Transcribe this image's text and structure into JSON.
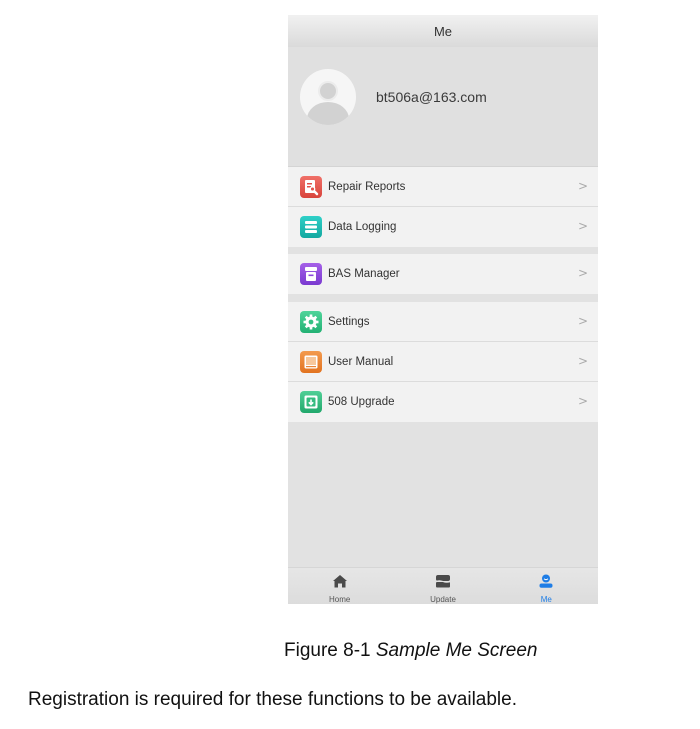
{
  "screen": {
    "header": {
      "title": "Me"
    },
    "profile": {
      "email": "bt506a@163.com",
      "avatar_icon": "user-avatar-icon"
    },
    "menu_groups": [
      {
        "items": [
          {
            "label": "Repair Reports",
            "icon": "repair-report-icon",
            "color": "#e0514a"
          },
          {
            "label": "Data Logging",
            "icon": "data-logging-icon",
            "color": "#1fbdb5"
          }
        ]
      },
      {
        "items": [
          {
            "label": "BAS Manager",
            "icon": "bas-manager-icon",
            "color": "#8c48dc"
          }
        ]
      },
      {
        "items": [
          {
            "label": "Settings",
            "icon": "gear-icon",
            "color": "#36c185"
          },
          {
            "label": "User Manual",
            "icon": "book-icon",
            "color": "#ea8434"
          },
          {
            "label": "508 Upgrade",
            "icon": "upgrade-icon",
            "color": "#34bc80"
          }
        ]
      }
    ],
    "chevron": ">",
    "tabbar": [
      {
        "label": "Home",
        "icon": "home-icon",
        "active": false
      },
      {
        "label": "Update",
        "icon": "update-icon",
        "active": false
      },
      {
        "label": "Me",
        "icon": "person-icon",
        "active": true
      }
    ],
    "accent_color": "#1e7de6"
  },
  "document": {
    "caption_prefix": "Figure 8-1 ",
    "caption_title": "Sample Me Screen",
    "paragraph": "Registration is required for these functions to be available."
  }
}
